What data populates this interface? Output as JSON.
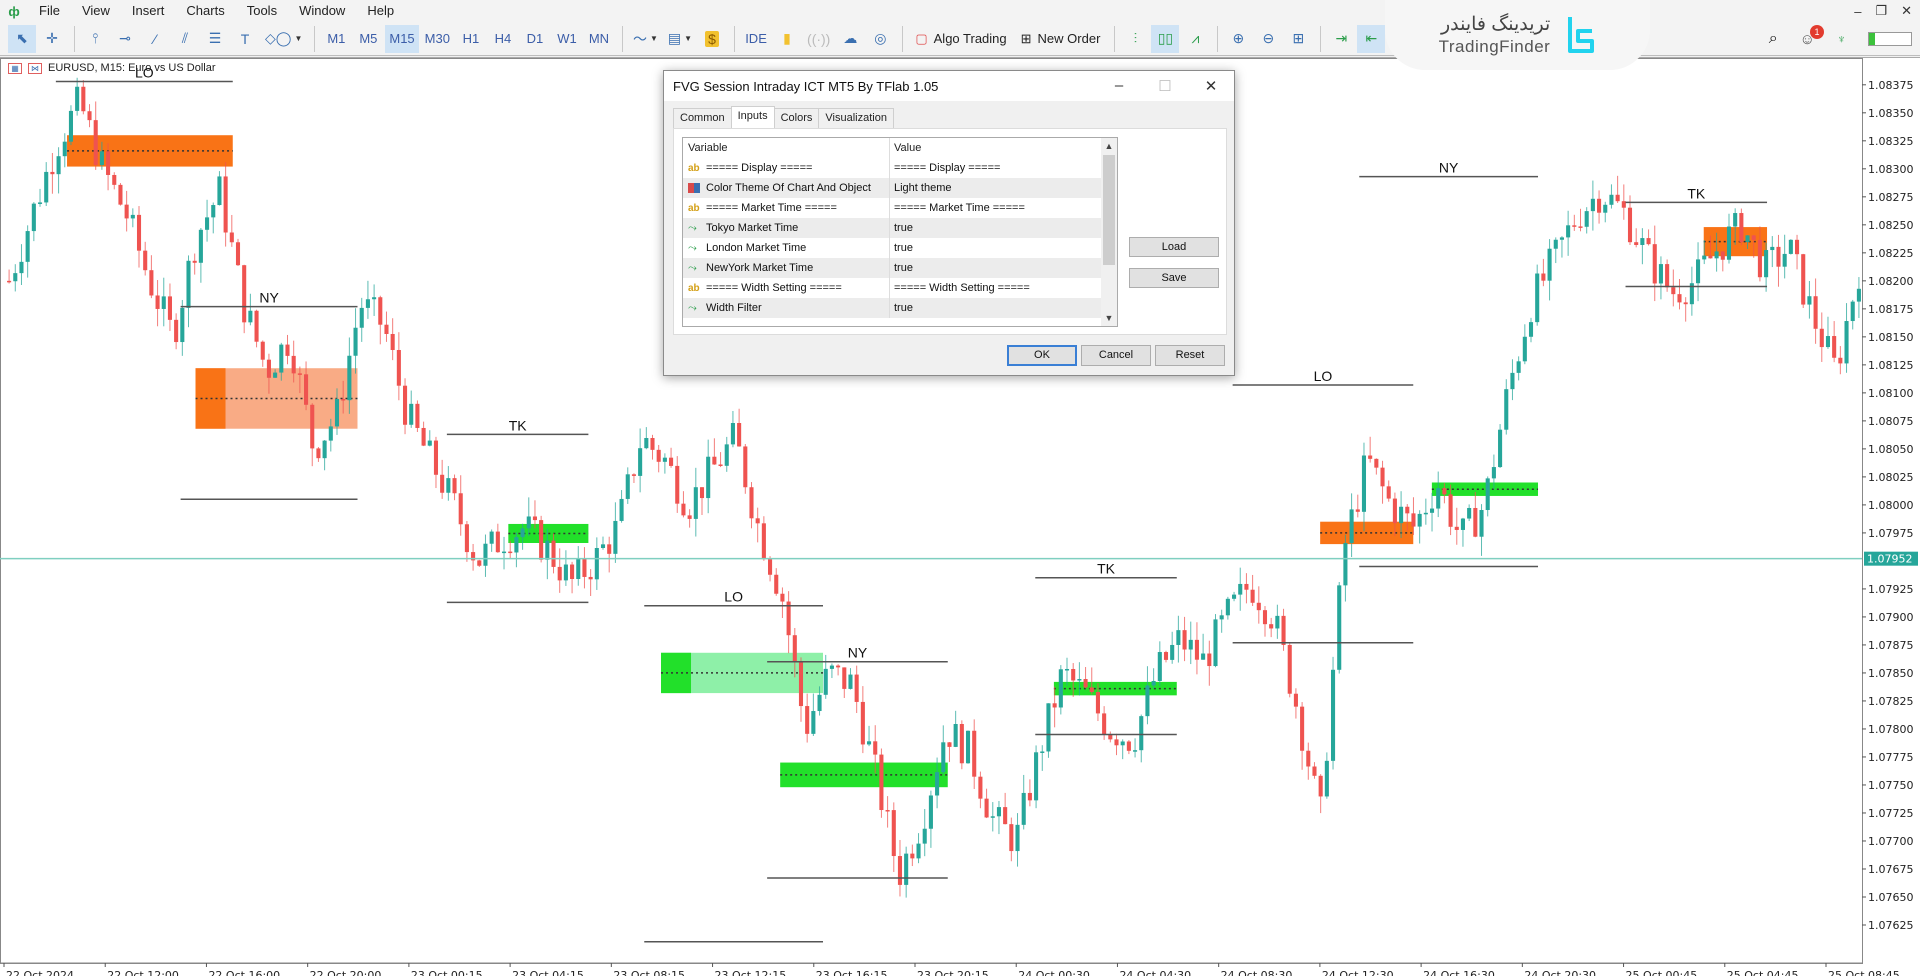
{
  "menu": {
    "items": [
      "File",
      "View",
      "Insert",
      "Charts",
      "Tools",
      "Window",
      "Help"
    ]
  },
  "toolbar": {
    "timeframes": [
      "M1",
      "M5",
      "M15",
      "M30",
      "H1",
      "H4",
      "D1",
      "W1",
      "MN"
    ],
    "active_timeframe": "M15",
    "ide_label": "IDE",
    "algo_trading_label": "Algo Trading",
    "new_order_label": "New Order"
  },
  "brand": {
    "name_fa": "تریدینگ فایندر",
    "name_en": "TradingFinder",
    "accent": "#22d3ee"
  },
  "status": {
    "notifications": "1",
    "connection_fill": 0.15
  },
  "chart": {
    "symbol_label": "EURUSD, M15:  Euro vs US Dollar",
    "current_price": "1.07952",
    "colors": {
      "bull": "#26a69a",
      "bear": "#ef5350",
      "orange_fvg": "#f97316",
      "orange_zone": "#f9ab85",
      "green_fvg": "#22e02a",
      "green_zone": "#8ef0a8",
      "price_line": "#7fcfc0"
    }
  },
  "chart_data": {
    "type": "candlestick",
    "title": "EURUSD, M15:  Euro vs US Dollar",
    "ylim": [
      1.076,
      1.084
    ],
    "y_ticks": [
      "1.08375",
      "1.08350",
      "1.08325",
      "1.08300",
      "1.08275",
      "1.08250",
      "1.08225",
      "1.08200",
      "1.08175",
      "1.08150",
      "1.08125",
      "1.08100",
      "1.08075",
      "1.08050",
      "1.08025",
      "1.08000",
      "1.07975",
      "1.07925",
      "1.07900",
      "1.07875",
      "1.07850",
      "1.07825",
      "1.07800",
      "1.07775",
      "1.07750",
      "1.07725",
      "1.07700",
      "1.07675",
      "1.07650",
      "1.07625"
    ],
    "x_ticks": [
      "22 Oct 2024",
      "22 Oct 12:00",
      "22 Oct 16:00",
      "22 Oct 20:00",
      "23 Oct 00:15",
      "23 Oct 04:15",
      "23 Oct 08:15",
      "23 Oct 12:15",
      "23 Oct 16:15",
      "23 Oct 20:15",
      "24 Oct 00:30",
      "24 Oct 04:30",
      "24 Oct 08:30",
      "24 Oct 12:30",
      "24 Oct 16:30",
      "24 Oct 20:30",
      "25 Oct 00:45",
      "25 Oct 04:45",
      "25 Oct 08:45"
    ],
    "current_price": 1.07952,
    "price_path": [
      1.082,
      1.0826,
      1.0832,
      1.0836,
      1.083,
      1.0826,
      1.082,
      1.0815,
      1.0824,
      1.0828,
      1.0818,
      1.0812,
      1.0815,
      1.0805,
      1.0808,
      1.0818,
      1.0816,
      1.0808,
      1.0804,
      1.08,
      1.0795,
      1.0797,
      1.0798,
      1.0796,
      1.0793,
      1.0795,
      1.0798,
      1.0806,
      1.0804,
      1.08,
      1.0803,
      1.0806,
      1.0798,
      1.0792,
      1.078,
      1.0785,
      1.0784,
      1.0776,
      1.0767,
      1.0772,
      1.078,
      1.0778,
      1.0772,
      1.077,
      1.0778,
      1.0785,
      1.0783,
      1.078,
      1.0779,
      1.0785,
      1.0788,
      1.0786,
      1.079,
      1.0793,
      1.079,
      1.0782,
      1.0772,
      1.0796,
      1.0804,
      1.08,
      1.0798,
      1.0802,
      1.0797,
      1.08,
      1.081,
      1.0818,
      1.0822,
      1.0826,
      1.0828,
      1.0826,
      1.0822,
      1.0819,
      1.082,
      1.0823,
      1.0825,
      1.0821,
      1.0823,
      1.0817,
      1.0812,
      1.0821
    ],
    "sessions": [
      {
        "label": "LO",
        "x_start": 0.03,
        "x_end": 0.125,
        "high": 1.08378,
        "low": null
      },
      {
        "label": "NY",
        "x_start": 0.097,
        "x_end": 0.192,
        "high": 1.08177,
        "low": 1.08005
      },
      {
        "label": "TK",
        "x_start": 0.24,
        "x_end": 0.316,
        "high": 1.08063,
        "low": 1.07913
      },
      {
        "label": "LO",
        "x_start": 0.346,
        "x_end": 0.442,
        "high": 1.0791,
        "low": 1.0761
      },
      {
        "label": "NY",
        "x_start": 0.412,
        "x_end": 0.509,
        "high": 1.0786,
        "low": 1.07667
      },
      {
        "label": "TK",
        "x_start": 0.556,
        "x_end": 0.632,
        "high": 1.07935,
        "low": 1.07795
      },
      {
        "label": "LO",
        "x_start": 0.662,
        "x_end": 0.759,
        "high": 1.08107,
        "low": 1.07877
      },
      {
        "label": "NY",
        "x_start": 0.73,
        "x_end": 0.826,
        "high": 1.08293,
        "low": 1.07945
      },
      {
        "label": "TK",
        "x_start": 0.873,
        "x_end": 0.949,
        "high": 1.0827,
        "low": 1.08195
      }
    ],
    "fvg_zones": [
      {
        "type": "bearish",
        "x_start": 0.036,
        "x_end": 0.125,
        "top": 1.0833,
        "bottom": 1.08302
      },
      {
        "type": "bearish",
        "x_start": 0.105,
        "x_end": 0.192,
        "top": 1.08122,
        "bottom": 1.08068
      },
      {
        "type": "bullish",
        "x_start": 0.273,
        "x_end": 0.316,
        "top": 1.07983,
        "bottom": 1.07966
      },
      {
        "type": "bullish",
        "x_start": 0.355,
        "x_end": 0.442,
        "top": 1.07868,
        "bottom": 1.07832
      },
      {
        "type": "bullish",
        "x_start": 0.419,
        "x_end": 0.509,
        "top": 1.0777,
        "bottom": 1.07748
      },
      {
        "type": "bullish",
        "x_start": 0.566,
        "x_end": 0.632,
        "top": 1.07842,
        "bottom": 1.0783
      },
      {
        "type": "bearish",
        "x_start": 0.709,
        "x_end": 0.759,
        "top": 1.07985,
        "bottom": 1.07965
      },
      {
        "type": "bullish",
        "x_start": 0.769,
        "x_end": 0.826,
        "top": 1.0802,
        "bottom": 1.08008
      },
      {
        "type": "bearish",
        "x_start": 0.915,
        "x_end": 0.949,
        "top": 1.08248,
        "bottom": 1.08222
      }
    ]
  },
  "dialog": {
    "title": "FVG Session Intraday ICT MT5 By TFlab 1.05",
    "tabs": [
      "Common",
      "Inputs",
      "Colors",
      "Visualization"
    ],
    "active_tab": "Inputs",
    "columns": [
      "Variable",
      "Value"
    ],
    "rows": [
      {
        "icon": "ab",
        "variable": "===== Display =====",
        "value": "===== Display ====="
      },
      {
        "icon": "color",
        "variable": "Color Theme Of Chart And Object",
        "value": "Light theme"
      },
      {
        "icon": "ab",
        "variable": "===== Market Time =====",
        "value": "===== Market Time ====="
      },
      {
        "icon": "toggle",
        "variable": "Tokyo Market Time",
        "value": "true"
      },
      {
        "icon": "toggle",
        "variable": "London Market Time",
        "value": "true"
      },
      {
        "icon": "toggle",
        "variable": "NewYork Market Time",
        "value": "true"
      },
      {
        "icon": "ab",
        "variable": "===== Width Setting =====",
        "value": "===== Width Setting ====="
      },
      {
        "icon": "toggle",
        "variable": "Width Filter",
        "value": "true"
      }
    ],
    "load_label": "Load",
    "save_label": "Save",
    "ok_label": "OK",
    "cancel_label": "Cancel",
    "reset_label": "Reset"
  }
}
